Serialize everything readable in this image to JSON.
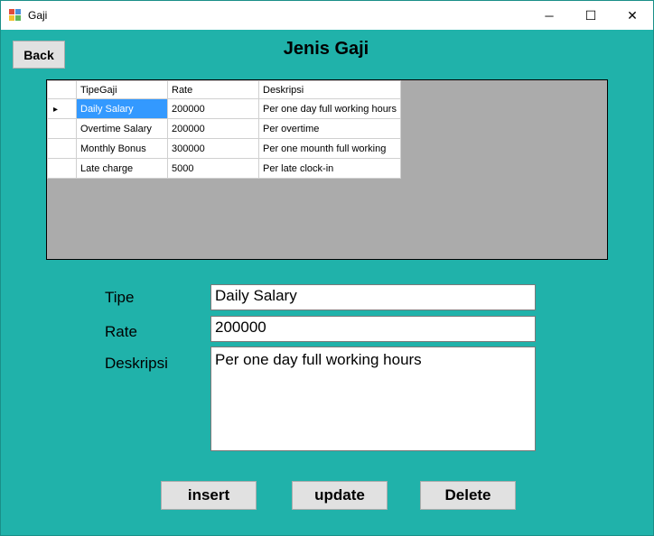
{
  "window": {
    "title": "Gaji",
    "minimize_glyph": "─",
    "maximize_glyph": "☐",
    "close_glyph": "✕"
  },
  "header": {
    "back_label": "Back",
    "page_title": "Jenis Gaji"
  },
  "grid": {
    "columns": [
      "TipeGaji",
      "Rate",
      "Deskripsi"
    ],
    "rows": [
      [
        "Daily Salary",
        "200000",
        "Per one day full working hours"
      ],
      [
        "Overtime Salary",
        "200000",
        "Per overtime"
      ],
      [
        "Monthly Bonus",
        "300000",
        "Per one mounth full working"
      ],
      [
        "Late charge",
        "5000",
        "Per late clock-in"
      ]
    ],
    "selected_row": 0,
    "row_indicator": "▸"
  },
  "form": {
    "tipe_label": "Tipe",
    "tipe_value": "Daily Salary",
    "rate_label": "Rate",
    "rate_value": "200000",
    "deskripsi_label": "Deskripsi",
    "deskripsi_value": "Per one day full working hours"
  },
  "actions": {
    "insert_label": "insert",
    "update_label": "update",
    "delete_label": "Delete"
  },
  "colors": {
    "background": "#20b2aa",
    "selection": "#3399ff",
    "grid_bg": "#ababab"
  }
}
